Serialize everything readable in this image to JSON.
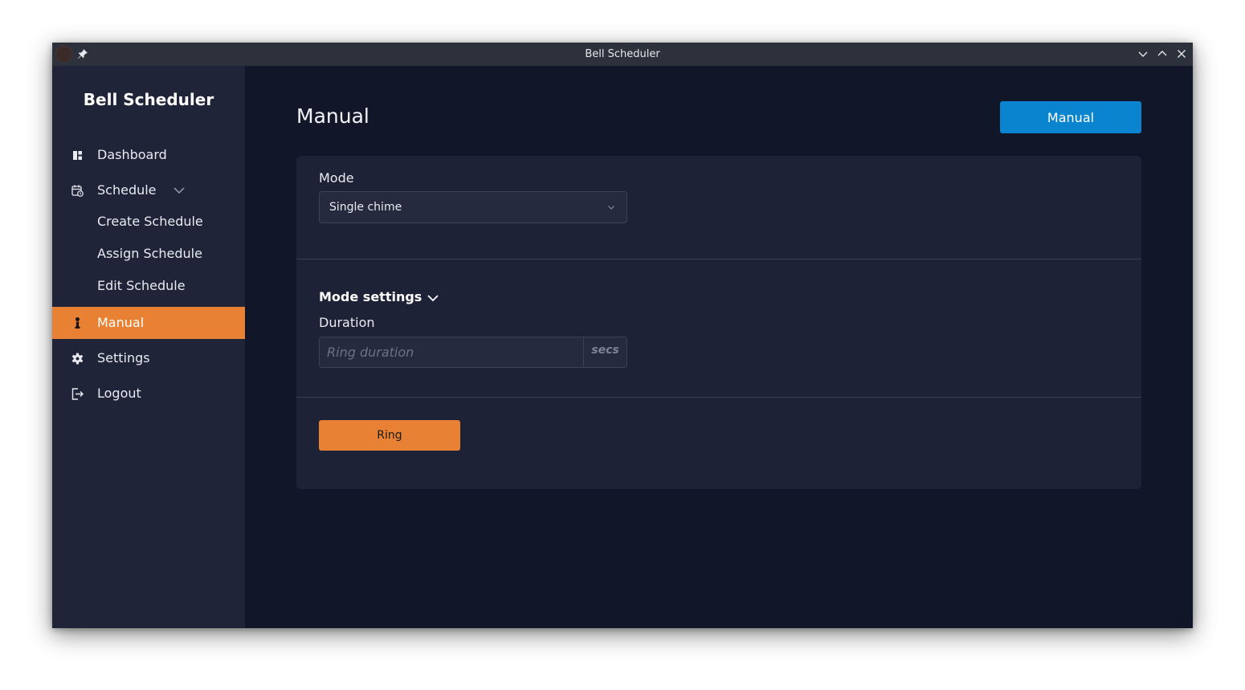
{
  "window": {
    "title": "Bell Scheduler"
  },
  "sidebar": {
    "brand": "Bell Scheduler",
    "items": [
      {
        "label": "Dashboard",
        "icon": "dashboard-icon"
      },
      {
        "label": "Schedule",
        "icon": "calendar-clock-icon",
        "expanded": true,
        "children": [
          {
            "label": "Create Schedule"
          },
          {
            "label": "Assign Schedule"
          },
          {
            "label": "Edit Schedule"
          }
        ]
      },
      {
        "label": "Manual",
        "icon": "person-icon",
        "active": true
      },
      {
        "label": "Settings",
        "icon": "gear-icon"
      },
      {
        "label": "Logout",
        "icon": "logout-icon"
      }
    ]
  },
  "main": {
    "title": "Manual",
    "header_button": "Manual",
    "mode": {
      "label": "Mode",
      "value": "Single chime"
    },
    "mode_settings": {
      "label": "Mode settings",
      "duration": {
        "label": "Duration",
        "placeholder": "Ring duration",
        "value": "",
        "unit": "secs"
      }
    },
    "ring_button": "Ring"
  },
  "colors": {
    "accent": "#e88133",
    "primary": "#0a84ce",
    "sidebar_bg": "#202439",
    "main_bg": "#111629",
    "card_bg": "#1e2236"
  }
}
